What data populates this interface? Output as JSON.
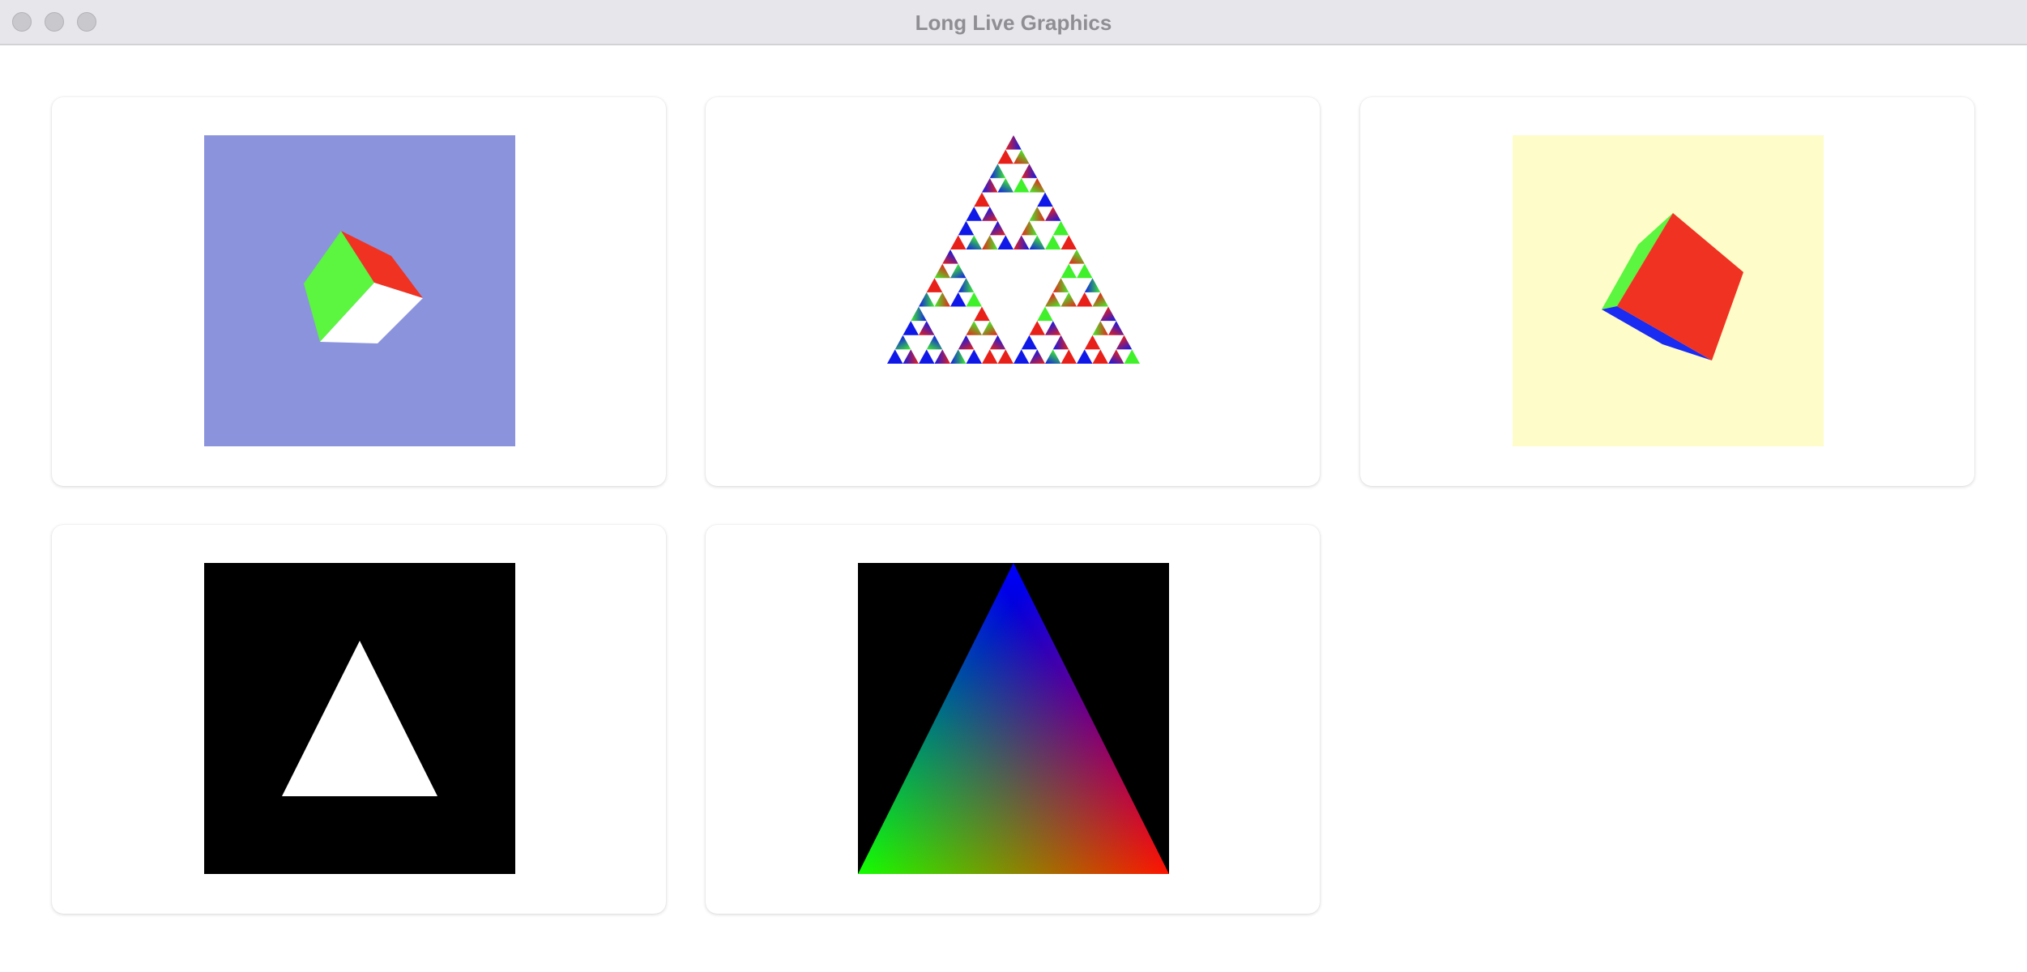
{
  "window": {
    "title": "Long Live Graphics"
  },
  "colors": {
    "titlebar": "#e7e6ea",
    "title_text": "#8f8e92",
    "cube_bg": "#8c93dd",
    "cube_green": "#5cf53f",
    "cube_red": "#f03222",
    "cube_white": "#ffffff",
    "cube_blue": "#1a2bf2",
    "yellow_bg": "#fefcc8",
    "black": "#000000"
  },
  "canvases": [
    {
      "id": "spinning-cube-blue-bg",
      "description_icon": "cube-icon"
    },
    {
      "id": "sierpinski-gasket",
      "description_icon": "fractal-icon"
    },
    {
      "id": "rotating-cube-yellow-bg",
      "description_icon": "cube-icon"
    },
    {
      "id": "white-triangle",
      "description_icon": "triangle-icon"
    },
    {
      "id": "rgb-gradient-triangle",
      "description_icon": "triangle-icon"
    }
  ]
}
